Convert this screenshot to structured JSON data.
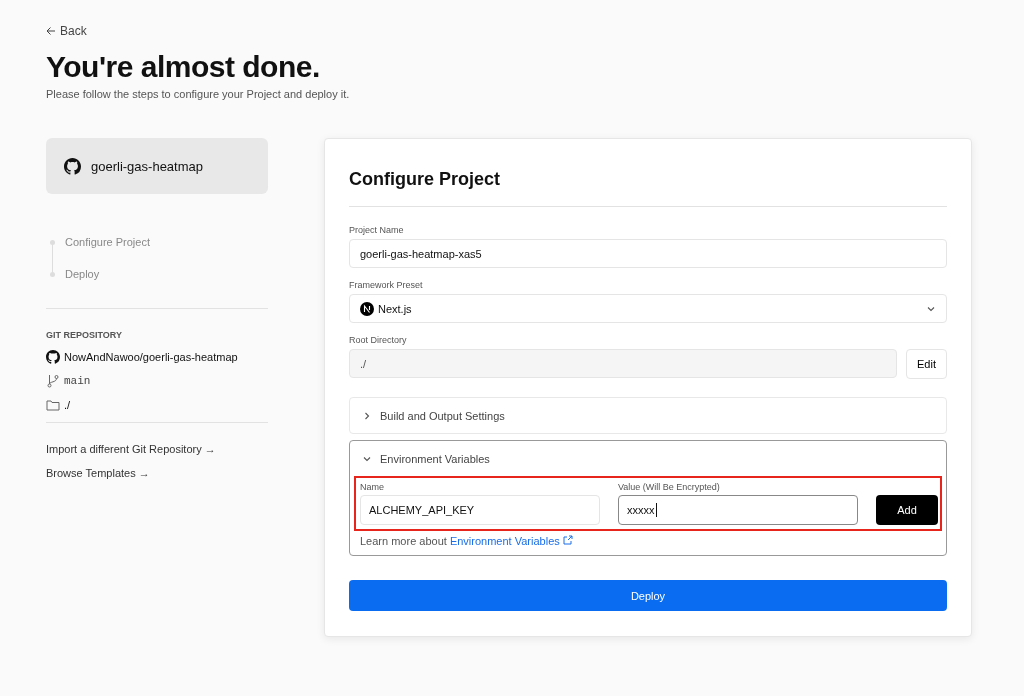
{
  "back": {
    "label": "Back"
  },
  "title": "You're almost done.",
  "subtitle": "Please follow the steps to configure your Project and deploy it.",
  "repo_card": {
    "name": "goerli-gas-heatmap"
  },
  "steps": [
    "Configure Project",
    "Deploy"
  ],
  "git": {
    "heading": "GIT REPOSITORY",
    "repo": "NowAndNawoo/goerli-gas-heatmap",
    "branch": "main",
    "directory": "./"
  },
  "links": [
    "Import a different Git Repository →",
    "Browse Templates →"
  ],
  "configure": {
    "title": "Configure Project",
    "project_name": {
      "label": "Project Name",
      "value": "goerli-gas-heatmap-xas5"
    },
    "framework": {
      "label": "Framework Preset",
      "value": "Next.js"
    },
    "root_directory": {
      "label": "Root Directory",
      "value": "./",
      "button": "Edit"
    },
    "sections": [
      {
        "title": "Build and Output Settings",
        "expanded": false
      },
      {
        "title": "Environment Variables",
        "expanded": true,
        "highlighted": true,
        "name_label": "Name",
        "name_value": "ALCHEMY_API_KEY",
        "value_label": "Value (Will Be Encrypted)",
        "value_value": "xxxxx",
        "add_button": "Add",
        "learn_more": "Learn more about",
        "learn_link": "Environment Variables"
      }
    ],
    "deploy_button": "Deploy"
  }
}
